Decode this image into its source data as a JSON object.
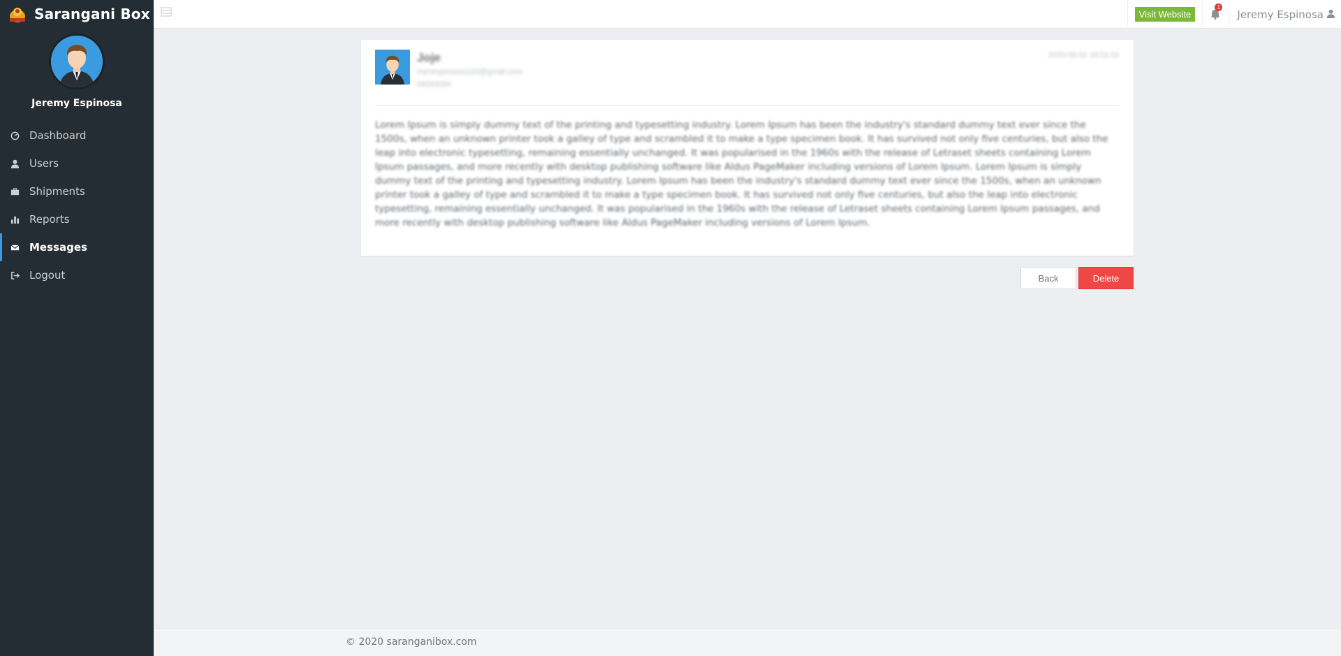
{
  "brand": {
    "name": "Sarangani Box"
  },
  "profile": {
    "name": "Jeremy Espinosa"
  },
  "nav": [
    {
      "label": "Dashboard",
      "icon": "dashboard-icon",
      "active": false
    },
    {
      "label": "Users",
      "icon": "user-icon",
      "active": false
    },
    {
      "label": "Shipments",
      "icon": "briefcase-icon",
      "active": false
    },
    {
      "label": "Reports",
      "icon": "bar-chart-icon",
      "active": false
    },
    {
      "label": "Messages",
      "icon": "envelope-icon",
      "active": true
    },
    {
      "label": "Logout",
      "icon": "logout-icon",
      "active": false
    }
  ],
  "topbar": {
    "visit_label": "Visit Website",
    "notification_count": "1",
    "user_name": "Jeremy Espinosa"
  },
  "message": {
    "sender_name": "Joje",
    "sender_email": "meriespinosa1120@gmail.com",
    "sender_phone": "09093094",
    "date": "2020-08-01 18:01:01",
    "body": "Lorem Ipsum is simply dummy text of the printing and typesetting industry. Lorem Ipsum has been the industry's standard dummy text ever since the 1500s, when an unknown printer took a galley of type and scrambled it to make a type specimen book. It has survived not only five centuries, but also the leap into electronic typesetting, remaining essentially unchanged. It was popularised in the 1960s with the release of Letraset sheets containing Lorem Ipsum passages, and more recently with desktop publishing software like Aldus PageMaker including versions of Lorem Ipsum. Lorem Ipsum is simply dummy text of the printing and typesetting industry. Lorem Ipsum has been the industry's standard dummy text ever since the 1500s, when an unknown printer took a galley of type and scrambled it to make a type specimen book. It has survived not only five centuries, but also the leap into electronic typesetting, remaining essentially unchanged. It was popularised in the 1960s with the release of Letraset sheets containing Lorem Ipsum passages, and more recently with desktop publishing software like Aldus PageMaker including versions of Lorem Ipsum."
  },
  "actions": {
    "back_label": "Back",
    "delete_label": "Delete"
  },
  "footer": {
    "text": "© 2020 saranganibox.com"
  },
  "colors": {
    "sidebar": "#242d33",
    "accent": "#3b9be0",
    "visit": "#7bb83a",
    "delete": "#ef4646"
  }
}
